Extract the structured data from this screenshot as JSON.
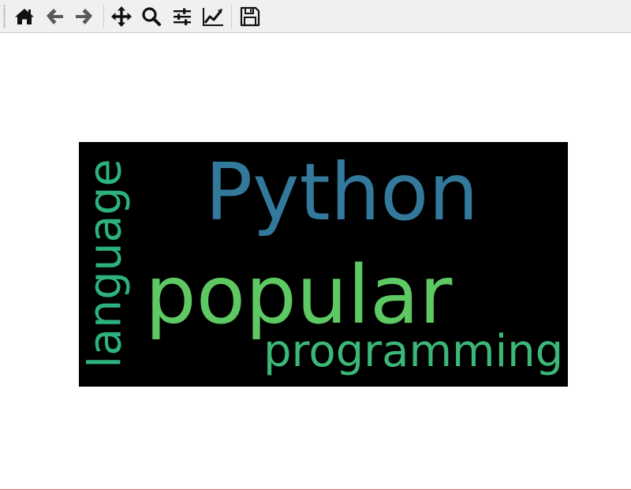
{
  "toolbar": {
    "tools": [
      {
        "icon": "home-icon",
        "label": "Home"
      },
      {
        "icon": "back-arrow-icon",
        "label": "Back"
      },
      {
        "icon": "forward-arrow-icon",
        "label": "Forward"
      },
      {
        "icon": "pan-move-icon",
        "label": "Pan"
      },
      {
        "icon": "zoom-magnifier-icon",
        "label": "Zoom"
      },
      {
        "icon": "configure-subplots-icon",
        "label": "Subplots"
      },
      {
        "icon": "edit-axis-chart-icon",
        "label": "Customize"
      },
      {
        "icon": "save-floppy-icon",
        "label": "Save"
      }
    ]
  },
  "wordcloud": {
    "background": "#000000",
    "words": [
      {
        "text": "Python",
        "color": "#33799b"
      },
      {
        "text": "popular",
        "color": "#5ec962"
      },
      {
        "text": "programming",
        "color": "#3bb878"
      },
      {
        "text": "language",
        "color": "#2db27d"
      }
    ]
  }
}
